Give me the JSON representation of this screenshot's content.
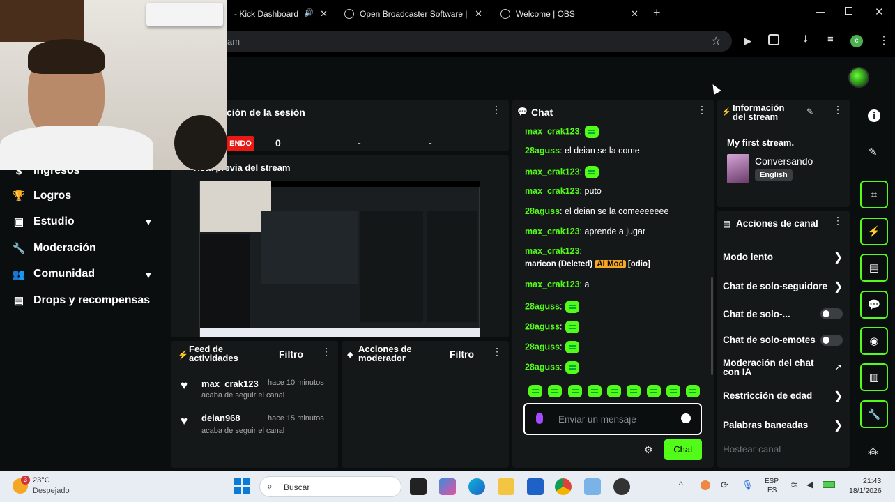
{
  "browser": {
    "tabs": [
      {
        "title": "- Kick Dashboard"
      },
      {
        "title": "Open Broadcaster Software | OI"
      },
      {
        "title": "Welcome | OBS"
      }
    ],
    "new_tab": "+",
    "address_text": "am",
    "profile_initial": "c"
  },
  "sidebar": {
    "items": [
      {
        "label": "Ingresos"
      },
      {
        "label": "Logros"
      },
      {
        "label": "Estudio"
      },
      {
        "label": "Moderación"
      },
      {
        "label": "Comunidad"
      },
      {
        "label": "Drops y recompensas"
      }
    ]
  },
  "session": {
    "title": "ción de la sesión",
    "live_badge": "ENDO",
    "stats": [
      "0",
      "-",
      "-"
    ]
  },
  "preview": {
    "title": "Vista previa del stream"
  },
  "feed": {
    "title_line1": "Feed de",
    "title_line2": "actividades",
    "filter": "Filtro",
    "events": [
      {
        "user": "max_crak123",
        "time": "hace 10 minutos",
        "desc": "acaba de seguir el canal"
      },
      {
        "user": "deian968",
        "time": "hace 15 minutos",
        "desc": "acaba de seguir el canal"
      }
    ]
  },
  "modactions": {
    "title_line1": "Acciones de",
    "title_line2": "moderador",
    "filter": "Filtro"
  },
  "chat": {
    "title": "Chat",
    "messages": [
      {
        "user": "max_crak123",
        "sep": ":",
        "text": ""
      },
      {
        "user": "28aguss",
        "sep": ":",
        "text": " el deian se la come"
      },
      {
        "user": "max_crak123",
        "sep": ":",
        "text": ""
      },
      {
        "user": "max_crak123",
        "sep": ":",
        "text": " puto"
      },
      {
        "user": "28aguss",
        "sep": ":",
        "text": " el deian se la comeeeeeee"
      },
      {
        "user": "max_crak123",
        "sep": ":",
        "text": " aprende a jugar"
      },
      {
        "user": "max_crak123",
        "sep": ":",
        "text": ""
      },
      {
        "user": "max_crak123",
        "sep": ":",
        "text": " a"
      },
      {
        "user": "28aguss",
        "sep": ":",
        "text": ""
      },
      {
        "user": "28aguss",
        "sep": ":",
        "text": ""
      },
      {
        "user": "28aguss",
        "sep": ":",
        "text": ""
      },
      {
        "user": "28aguss",
        "sep": ":",
        "text": ""
      }
    ],
    "deleted": {
      "word": "maricon",
      "label": "(Deleted)",
      "badge": "AI Mod",
      "reason": "[odio]"
    },
    "input_placeholder": "Enviar un mensaje",
    "send_label": "Chat"
  },
  "streaminfo": {
    "title_line1": "Información",
    "title_line2": "del stream",
    "stream_title": "My first stream.",
    "category": "Conversando",
    "language": "English"
  },
  "channel_actions": {
    "title": "Acciones de canal",
    "rows": [
      {
        "label": "Modo lento"
      },
      {
        "label": "Chat de solo-seguidores"
      },
      {
        "label": "Chat de solo-..."
      },
      {
        "label": "Chat de solo-emotes"
      },
      {
        "label": "Moderación del chat con IA"
      },
      {
        "label": "Restricción de edad"
      },
      {
        "label": "Palabras baneadas"
      },
      {
        "label": "Hostear canal"
      }
    ]
  },
  "taskbar": {
    "weather_temp": "23°C",
    "weather_desc": "Despejado",
    "weather_badge": "3",
    "search_placeholder": "Buscar",
    "lang1": "ESP",
    "lang2": "ES",
    "time": "21:43",
    "date": "18/1/2026"
  },
  "colors": {
    "accent": "#53fc18",
    "live": "#e91916",
    "ai_mod": "#f5a623"
  }
}
